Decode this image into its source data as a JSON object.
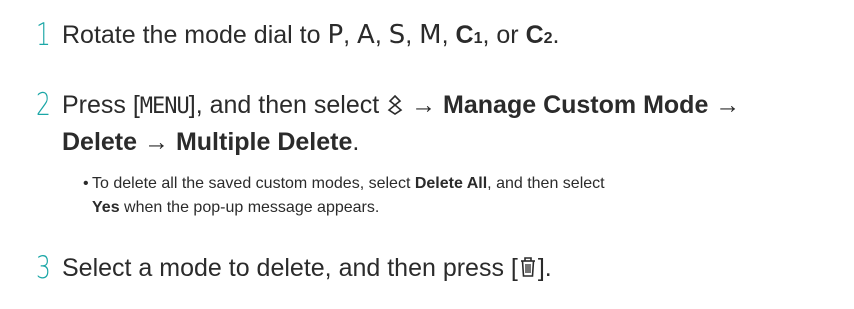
{
  "steps": [
    {
      "number": "1",
      "text_before": "Rotate the mode dial to ",
      "modes": [
        "P",
        "A",
        "S",
        "M"
      ],
      "sep": ", ",
      "c1_letter": "C",
      "c1_sub": "1",
      "or_text": ", or ",
      "c2_letter": "C",
      "c2_sub": "2",
      "period": "."
    },
    {
      "number": "2",
      "press": "Press [",
      "menu": "MENU",
      "after_menu": "], and then select ",
      "arrow1": " → ",
      "item1": "Manage Custom Mode",
      "arrow2": " →",
      "item2": "Delete",
      "arrow3": " → ",
      "item3": "Multiple Delete",
      "period": "."
    },
    {
      "number": "3",
      "text": "Select a mode to delete, and then press [",
      "close": "]."
    }
  ],
  "bullet": {
    "dot": "•",
    "part1": "To delete all the saved custom modes, select ",
    "bold1": "Delete All",
    "part2": ", and then select",
    "bold2": "Yes",
    "part3": " when the pop-up message appears."
  },
  "icons": {
    "custom_mode_icon": "custom-mode-icon",
    "trash_icon": "trash-icon"
  },
  "colors": {
    "accent": "#1aa6a6",
    "text": "#2b2b2b"
  }
}
